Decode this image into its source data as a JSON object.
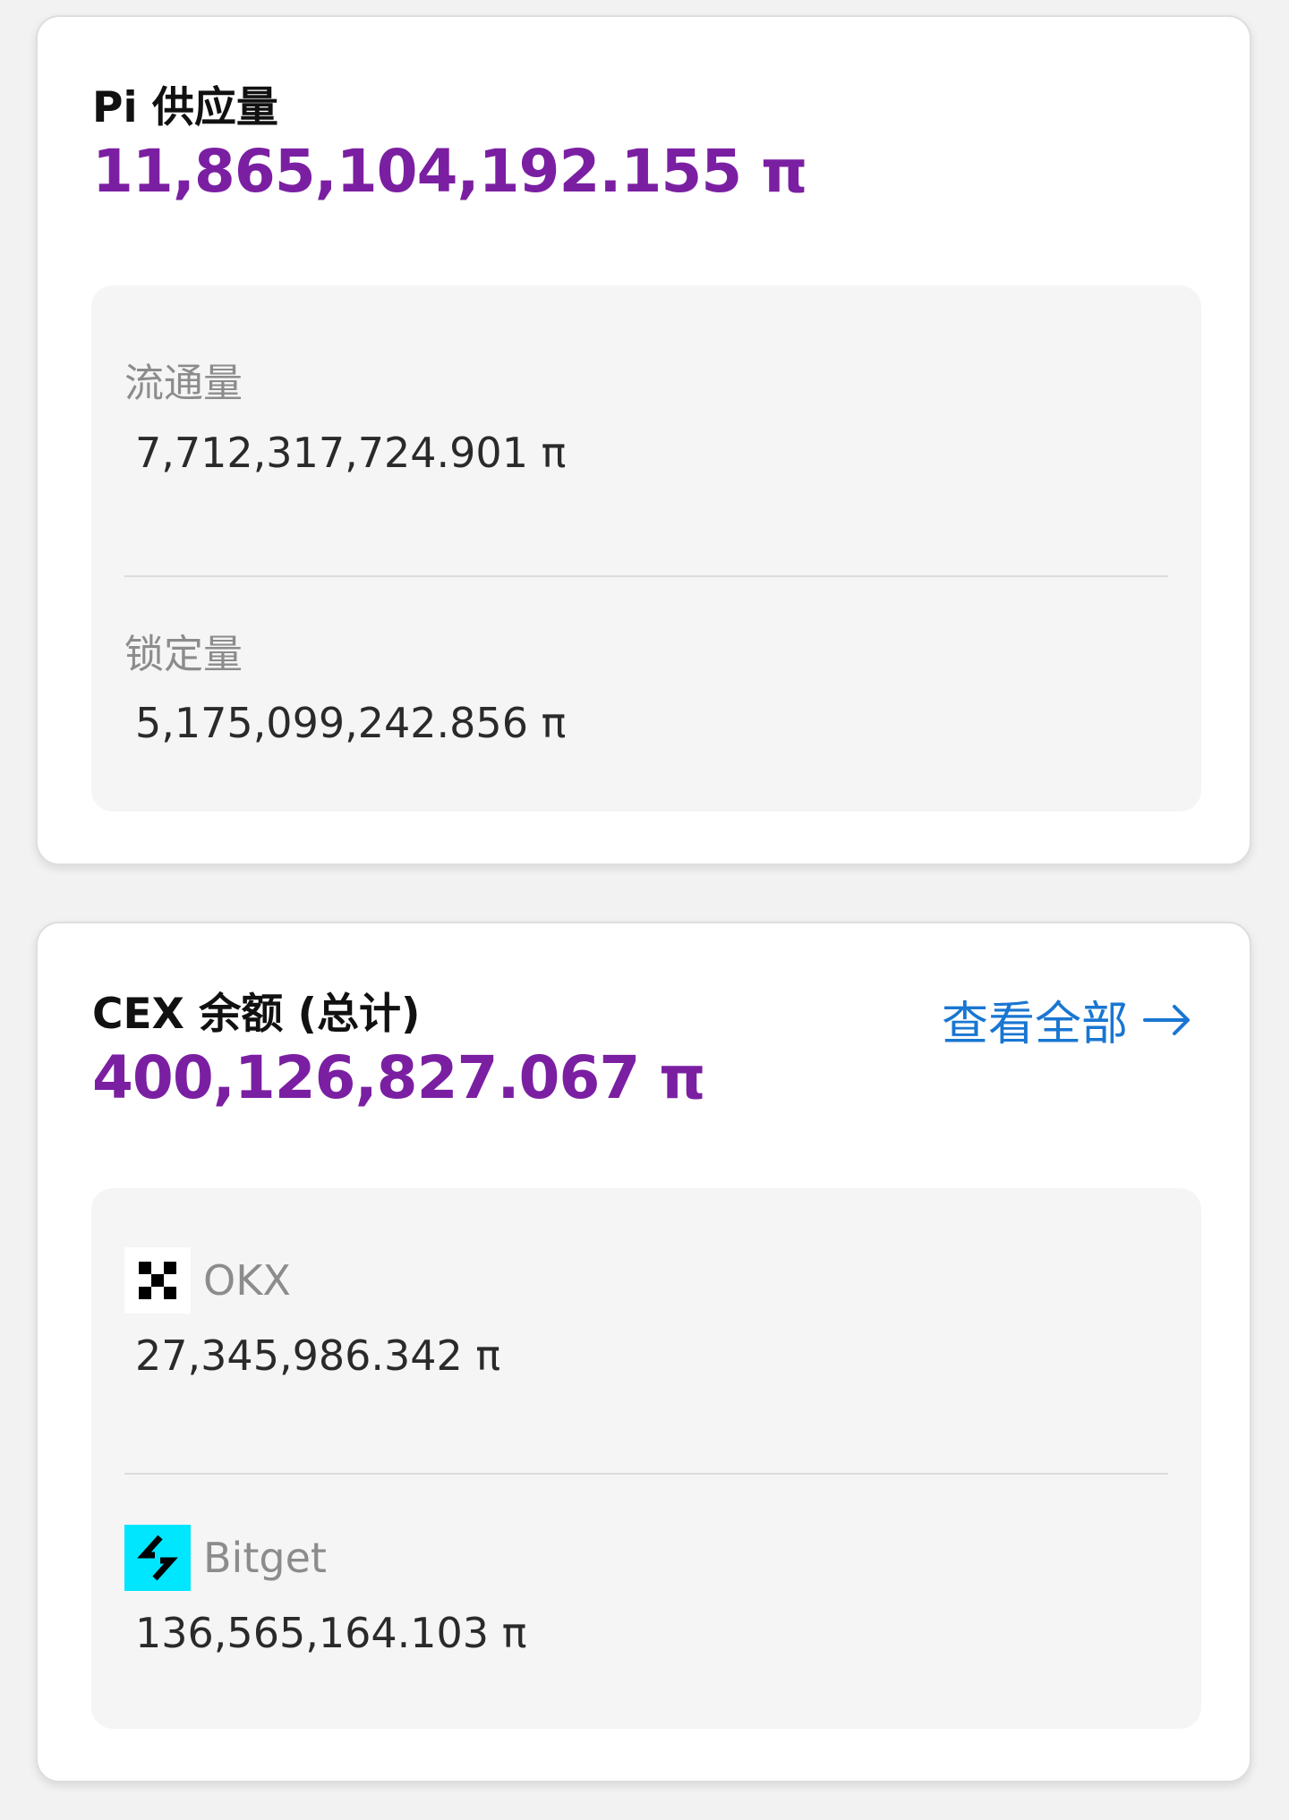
{
  "supply": {
    "title": "Pi 供应量",
    "total": "11,865,104,192.155 π",
    "accent_color": "#7b1fa2",
    "rows": [
      {
        "label": "流通量",
        "value": "7,712,317,724.901 π"
      },
      {
        "label": "锁定量",
        "value": "5,175,099,242.856 π"
      }
    ]
  },
  "cex": {
    "title": "CEX 余额 (总计)",
    "total": "400,126,827.067 π",
    "accent_color": "#7b1fa2",
    "view_all_label": "查看全部",
    "view_all_icon": "arrow-right-icon",
    "link_color": "#1976d2",
    "exchanges": [
      {
        "name": "OKX",
        "value": "27,345,986.342 π",
        "icon": "okx-logo-icon"
      },
      {
        "name": "Bitget",
        "value": "136,565,164.103 π",
        "icon": "bitget-logo-icon",
        "icon_color": "#00e6ff"
      }
    ]
  }
}
